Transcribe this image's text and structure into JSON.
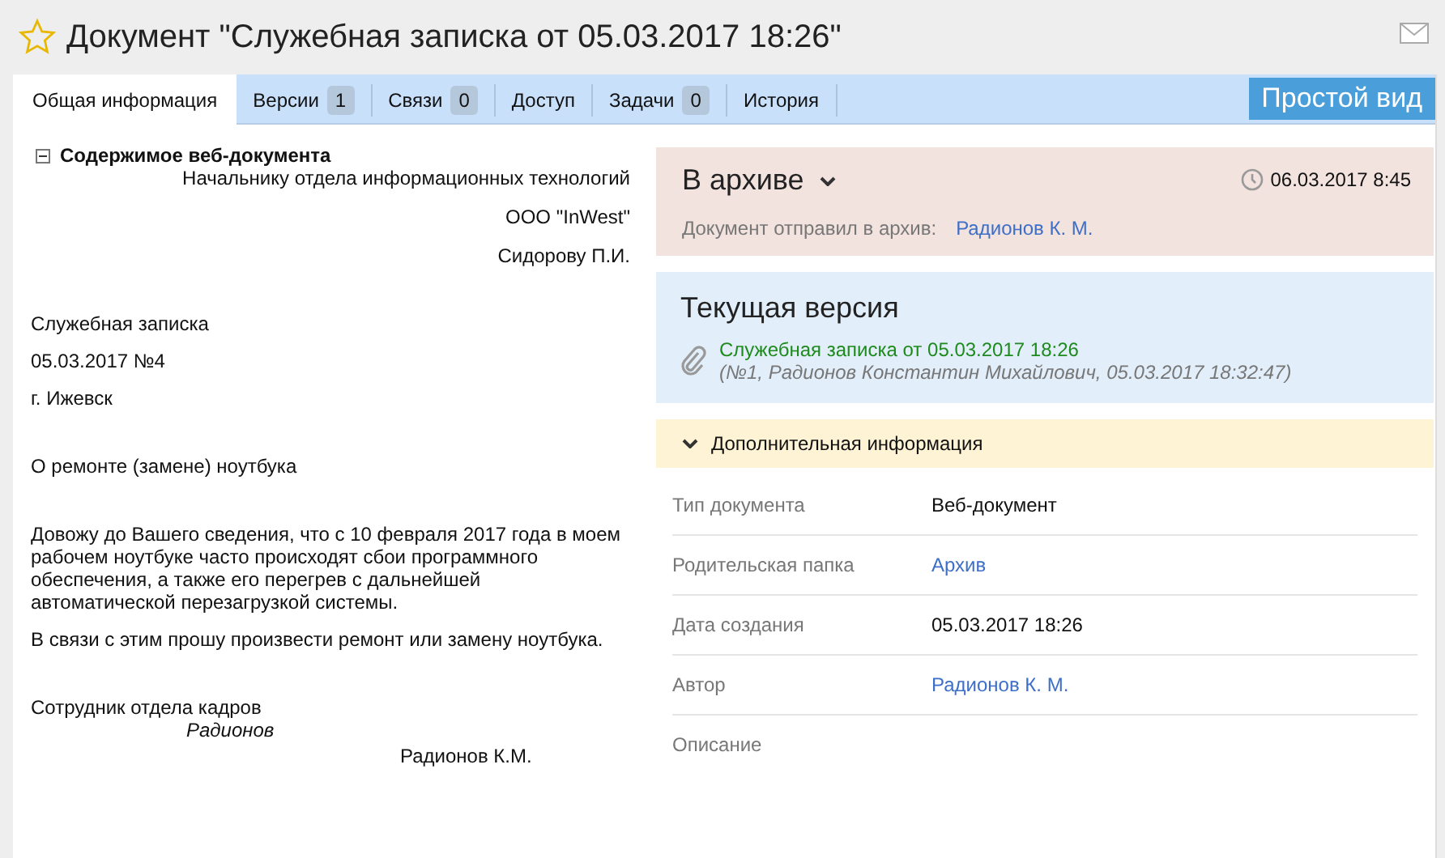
{
  "title": "Документ \"Служебная записка от 05.03.2017 18:26\"",
  "favorite": false,
  "tabs": [
    {
      "label": "Общая информация",
      "selected": true
    },
    {
      "label": "Версии",
      "count": "1",
      "selected": false
    },
    {
      "label": "Связи",
      "count": "0",
      "selected": false
    },
    {
      "label": "Доступ",
      "selected": false
    },
    {
      "label": "Задачи",
      "count": "0",
      "selected": false
    },
    {
      "label": "История",
      "selected": false
    }
  ],
  "simple_view_button": "Простой вид",
  "content": {
    "heading": "Содержимое веб-документа",
    "expanded": true,
    "blocks": [
      {
        "lines": [
          {
            "kind": "right",
            "text": "Начальнику отдела информационных технологий"
          },
          {
            "kind": "right",
            "text": "ООО \"InWest\""
          },
          {
            "kind": "right",
            "text": "Сидорову П.И."
          }
        ]
      },
      {
        "lines": [
          {
            "kind": "left",
            "text": "Служебная записка"
          },
          {
            "kind": "left",
            "text": "05.03.2017 №4"
          },
          {
            "kind": "left",
            "text": "г. Ижевск"
          }
        ]
      },
      {
        "lines": [
          {
            "kind": "left",
            "text": "О ремонте (замене) ноутбука"
          }
        ]
      },
      {
        "lines": [
          {
            "kind": "left",
            "text": "Довожу до Вашего сведения, что с 10 февраля 2017 года в моем рабочем ноутбуке часто происходят сбои программного обеспечения, а также его перегрев с дальнейшей автоматической перезагрузкой системы."
          },
          {
            "kind": "left",
            "text": "В связи с этим прошу произвести ремонт или замену ноутбука."
          }
        ]
      },
      {
        "lines": [
          {
            "kind": "tight",
            "text": "Сотрудник отдела кадров"
          },
          {
            "kind": "signature",
            "text": "Радионов"
          },
          {
            "kind": "name",
            "text": "Радионов К.М."
          }
        ]
      }
    ]
  },
  "status": {
    "label": "В архиве",
    "time": "06.03.2017 8:45",
    "sent_by_label": "Документ отправил в архив:",
    "sent_by": "Радионов К. М."
  },
  "current_version": {
    "title": "Текущая версия",
    "file": "Служебная записка от 05.03.2017 18:26",
    "details": "(№1, Радионов Константин Михайлович, 05.03.2017 18:32:47)"
  },
  "additional": {
    "title": "Дополнительная информация",
    "expanded": true,
    "rows": [
      {
        "label": "Тип документа",
        "value": "Веб-документ",
        "kind": "text"
      },
      {
        "label": "Родительская папка",
        "value": "Архив",
        "kind": "link"
      },
      {
        "label": "Дата создания",
        "value": "05.03.2017 18:26",
        "kind": "text"
      },
      {
        "label": "Автор",
        "value": "Радионов К. М.",
        "kind": "link"
      },
      {
        "label": "Описание"
      }
    ]
  }
}
